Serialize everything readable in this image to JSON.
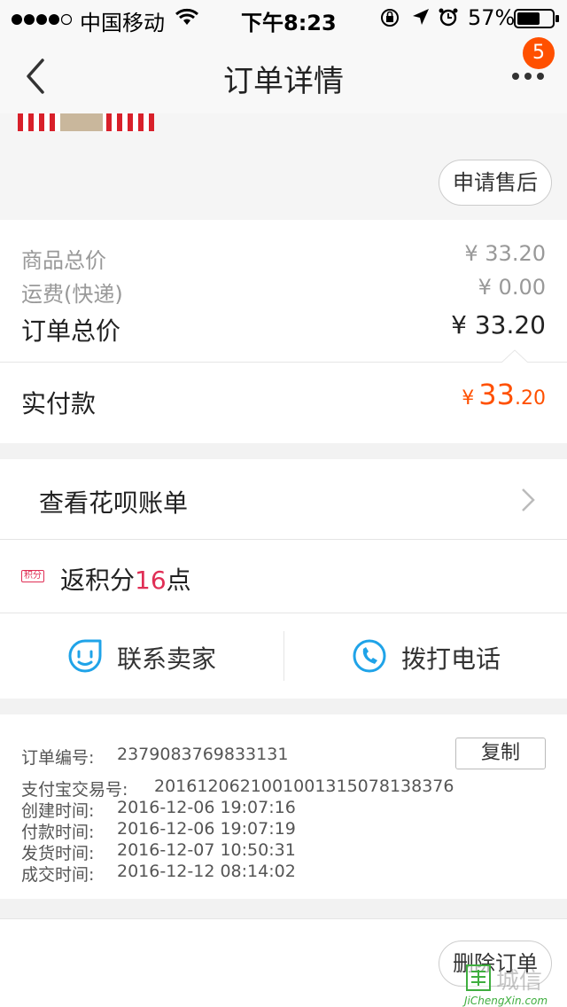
{
  "status": {
    "carrier": "中国移动",
    "time": "下午8:23",
    "battery": "57%"
  },
  "nav": {
    "title": "订单详情",
    "badge": "5"
  },
  "after_sale_button": "申请售后",
  "price": {
    "goods_label": "商品总价",
    "goods_value": "¥ 33.20",
    "shipping_label": "运费(快递)",
    "shipping_value": "¥ 0.00",
    "total_label": "订单总价",
    "total_value": "¥ 33.20",
    "paid_label": "实付款",
    "paid_symbol": "¥",
    "paid_int": "33",
    "paid_dec": ".20"
  },
  "huabei": {
    "label": "查看花呗账单"
  },
  "points": {
    "badge": "积分",
    "prefix": "返积分",
    "number": "16",
    "suffix": "点"
  },
  "contact": {
    "seller": "联系卖家",
    "phone": "拨打电话"
  },
  "order_info": {
    "order_no_label": "订单编号:",
    "order_no": "2379083769833131",
    "copy_button": "复制",
    "alipay_label": "支付宝交易号:",
    "alipay_no": "2016120621001001315078138376",
    "created_label": "创建时间:",
    "created": "2016-12-06 19:07:16",
    "paid_label": "付款时间:",
    "paid": "2016-12-06 19:07:19",
    "shipped_label": "发货时间:",
    "shipped": "2016-12-07 10:50:31",
    "completed_label": "成交时间:",
    "completed": "2016-12-12 08:14:02"
  },
  "delete_button": "删除订单",
  "watermark": {
    "text": "城信",
    "url": "JiChengXin.com"
  },
  "colors": {
    "accent": "#ff5000",
    "highlight": "#e02e55",
    "icon_blue": "#1fa3e8"
  }
}
